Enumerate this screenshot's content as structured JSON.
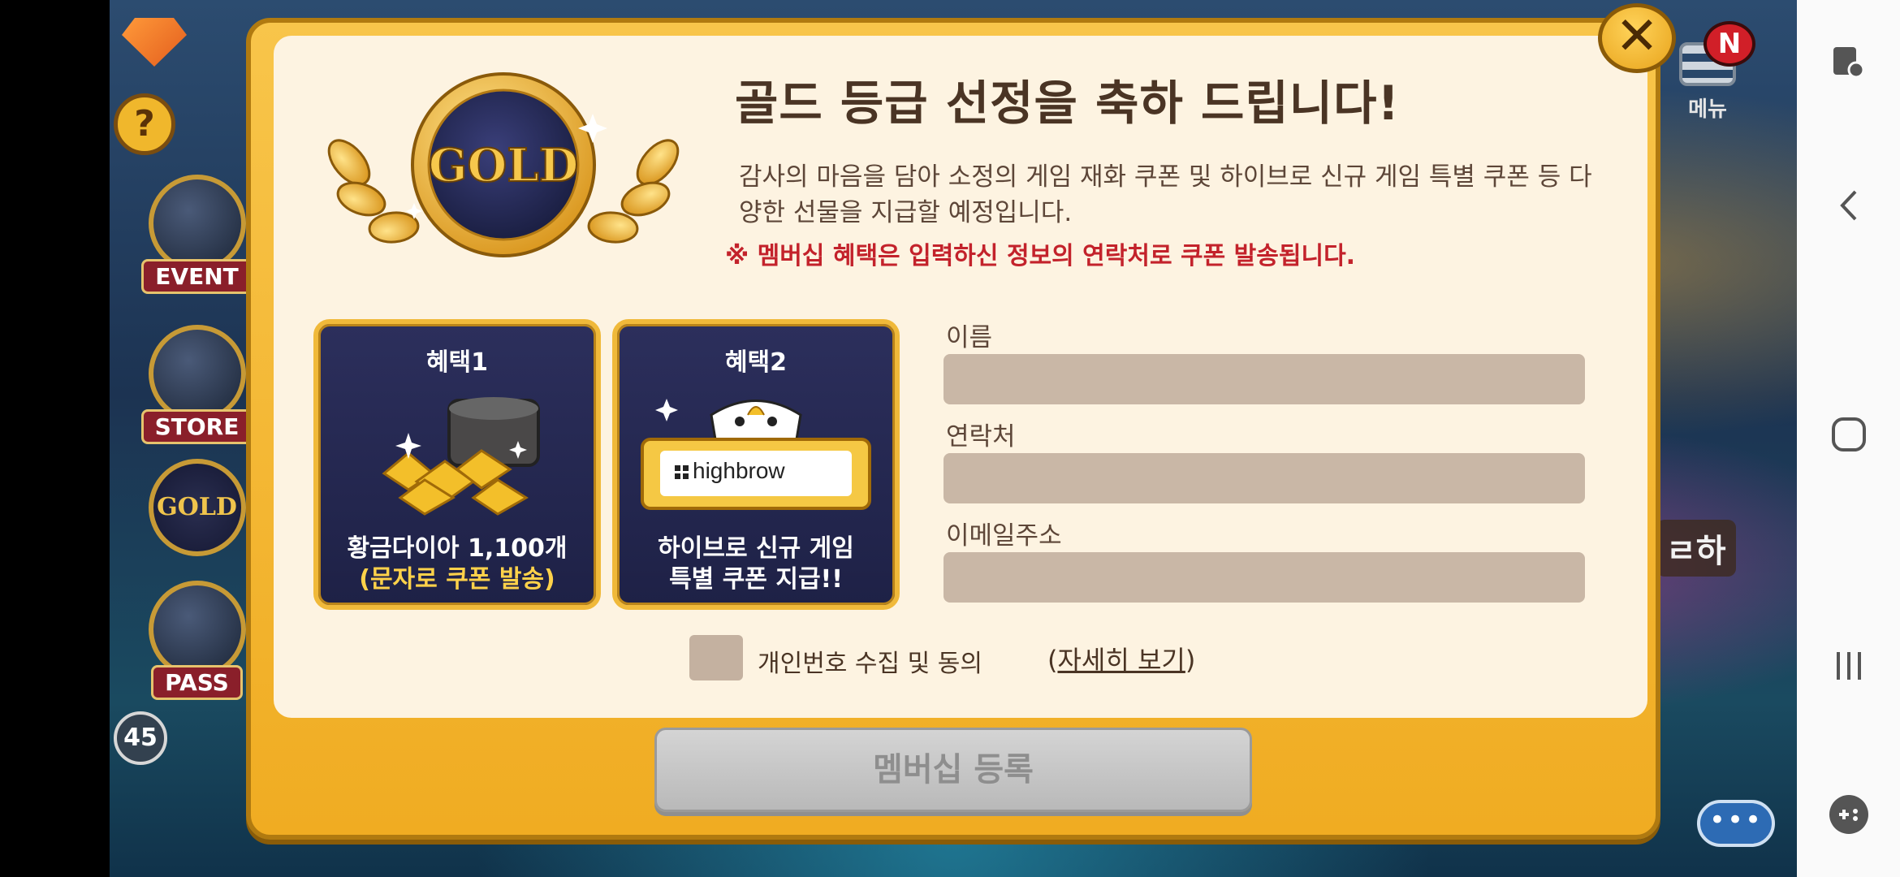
{
  "game": {
    "left_buttons": [
      {
        "label": "EVENT"
      },
      {
        "label": "STORE"
      },
      {
        "label": "GOLD"
      },
      {
        "label": "PASS"
      }
    ],
    "level": "45",
    "menu_label": "메뉴",
    "new_badge": "N",
    "question_mark": "?",
    "chat_dots": "•••",
    "right_peek_text": "ㄹ하"
  },
  "dialog": {
    "emblem_text": "GOLD",
    "title": "골드 등급 선정을 축하 드립니다!",
    "description": "감사의 마음을 담아 소정의 게임 재화 쿠폰 및 하이브로 신규 게임 특별 쿠폰 등 다양한 선물을 지급할 예정입니다.",
    "notice": "※ 멤버십 혜택은 입력하신 정보의 연락처로 쿠폰 발송됩니다.",
    "benefits": [
      {
        "title": "혜택1",
        "line1": "황금다이아 1,100개",
        "line2": "(문자로 쿠폰 발송)"
      },
      {
        "title": "혜택2",
        "line1": "하이브로 신규 게임",
        "line2": "특별 쿠폰 지급!!",
        "ticket_text": "highbrow"
      }
    ],
    "fields": {
      "name_label": "이름",
      "name_value": "",
      "phone_label": "연락처",
      "phone_value": "",
      "email_label": "이메일주소",
      "email_value": ""
    },
    "consent": {
      "label": "개인번호 수집 및 동의",
      "link": "자세히 보기",
      "checked": false
    },
    "register_button": "멤버십 등록",
    "close_symbol": "✕"
  },
  "colors": {
    "dialog_frame": "#f0ac22",
    "dialog_panel": "#fdf3e1",
    "notice_red": "#c3222b",
    "card_navy": "#1e2146",
    "button_disabled": "#c4c4c4"
  },
  "icons": [
    "gem-icon",
    "question-icon",
    "download-icon",
    "chest-icon",
    "gold-badge-icon",
    "pass-icon",
    "menu-icon",
    "chat-icon",
    "close-icon",
    "gold-emblem-icon",
    "gold-pile-icon",
    "ticket-icon",
    "android-back-icon",
    "android-home-icon",
    "android-recents-icon",
    "game-tools-icon",
    "screen-lock-icon"
  ]
}
